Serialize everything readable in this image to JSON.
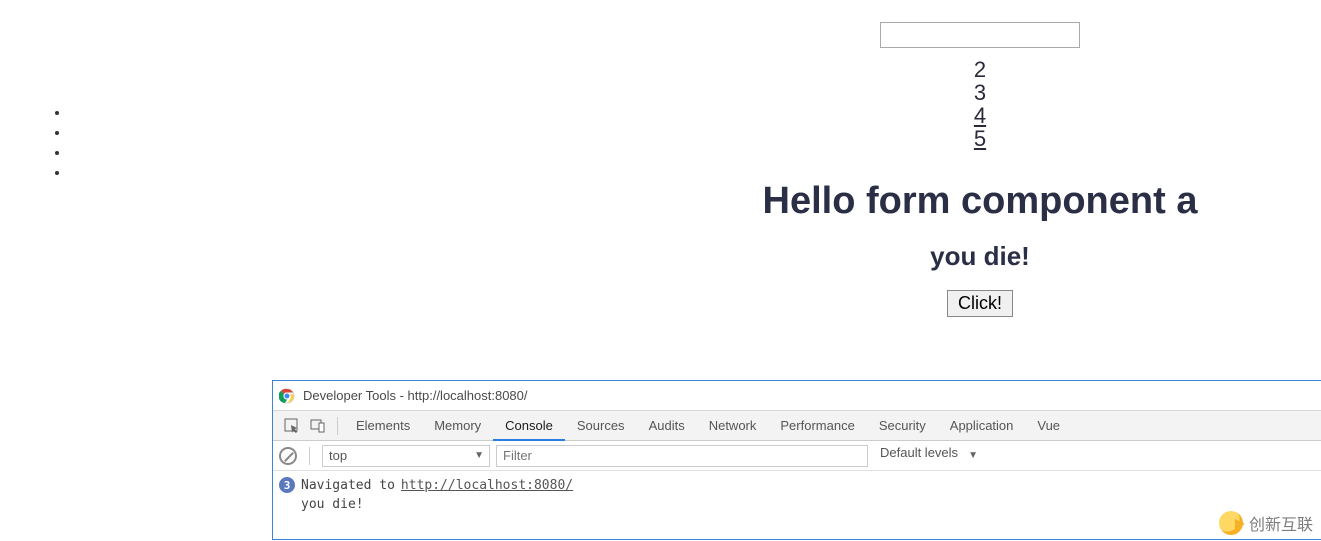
{
  "page": {
    "input_value": "",
    "numbers": [
      "2",
      "3",
      "4",
      "5"
    ],
    "heading1": "Hello form component a",
    "heading2": "you die!",
    "button_label": "Click!"
  },
  "devtools": {
    "title": "Developer Tools - http://localhost:8080/",
    "tabs": [
      "Elements",
      "Memory",
      "Console",
      "Sources",
      "Audits",
      "Network",
      "Performance",
      "Security",
      "Application",
      "Vue"
    ],
    "active_tab": "Console",
    "context_selected": "top",
    "filter_placeholder": "Filter",
    "levels_label": "Default levels",
    "console": {
      "nav_count": "3",
      "nav_prefix": "Navigated to ",
      "nav_url": "http://localhost:8080/",
      "log1": "you die!"
    }
  },
  "watermark": {
    "text": "创新互联"
  }
}
